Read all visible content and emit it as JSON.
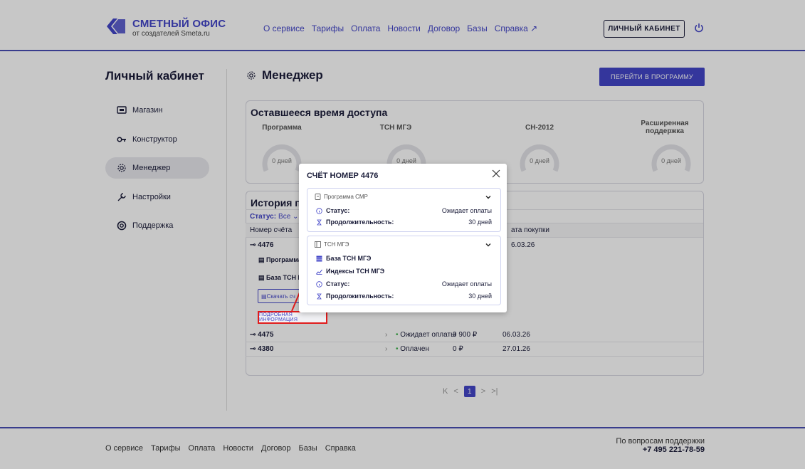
{
  "header": {
    "logo_title": "СМЕТНЫЙ ОФИС",
    "logo_sub": "от создателей Smeta.ru",
    "nav": [
      "О сервисе",
      "Тарифы",
      "Оплата",
      "Новости",
      "Договор",
      "Базы",
      "Справка ↗"
    ],
    "cabinet_button": "ЛИЧНЫЙ КАБИНЕТ"
  },
  "sidebar": {
    "title": "Личный кабинет",
    "items": [
      {
        "label": "Магазин",
        "icon": "shop-icon"
      },
      {
        "label": "Конструктор",
        "icon": "key-icon"
      },
      {
        "label": "Менеджер",
        "icon": "gear-icon",
        "active": true
      },
      {
        "label": "Настройки",
        "icon": "wrench-icon"
      },
      {
        "label": "Поддержка",
        "icon": "lifebuoy-icon"
      }
    ]
  },
  "main": {
    "title": "Менеджер",
    "go_button": "ПЕРЕЙТИ В ПРОГРАММУ",
    "access": {
      "title": "Оставшееся время доступа",
      "gauges": [
        {
          "label": "Программа",
          "value": "0 дней"
        },
        {
          "label": "ТСН МГЭ",
          "value": "0 дней"
        },
        {
          "label": "СН-2012",
          "value": "0 дней"
        },
        {
          "label": "Расширенная поддержка",
          "value": "0 дней"
        }
      ]
    },
    "history": {
      "title": "История пок",
      "status_label": "Статус:",
      "status_value": "Все ⌄",
      "col_number": "Номер счёта",
      "col_date": "ата покупки",
      "expanded": {
        "number": "4476",
        "date": "6.03.26",
        "item1": "Программа",
        "item2": "База ТСН МГ",
        "download": "Скачать сч",
        "details": "ПОДРОБНАЯ ИНФОРМАЦИЯ"
      },
      "rows": [
        {
          "number": "4475",
          "status": "Ожидает оплаты",
          "sum": "9 900 ₽",
          "date": "06.03.26"
        },
        {
          "number": "4380",
          "status": "Оплачен",
          "sum": "0 ₽",
          "date": "27.01.26"
        }
      ]
    },
    "pager": {
      "first": "K",
      "prev": "<",
      "current": "1",
      "next": ">",
      "last": ">|"
    }
  },
  "footer": {
    "nav": [
      "О сервисе",
      "Тарифы",
      "Оплата",
      "Новости",
      "Договор",
      "Базы",
      "Справка"
    ],
    "support_label": "По вопросам поддержки",
    "phone": "+7 495 221-78-59"
  },
  "modal": {
    "title": "СЧЁТ НОМЕР 4476",
    "panel1": {
      "name": "Программа СМР",
      "status_label": "Статус:",
      "status_value": "Ожидает оплаты",
      "duration_label": "Продолжительность:",
      "duration_value": "30 дней"
    },
    "panel2": {
      "name": "ТСН МГЭ",
      "item1": "База ТСН МГЭ",
      "item2": "Индексы ТСН МГЭ",
      "status_label": "Статус:",
      "status_value": "Ожидает оплаты",
      "duration_label": "Продолжительность:",
      "duration_value": "30 дней"
    }
  },
  "colors": {
    "accent": "#4346c8",
    "annotation": "#e01b1b",
    "status_green": "#3bb24a"
  }
}
